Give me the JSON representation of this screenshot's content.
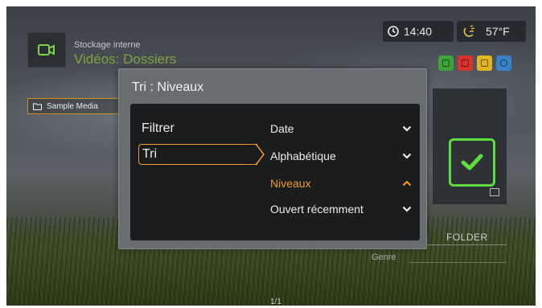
{
  "header": {
    "breadcrumb_top": "Stockage interne",
    "title": "Vidéos: Dossiers",
    "time": "14:40",
    "temperature": "57°F"
  },
  "color_keys": [
    {
      "name": "green-key",
      "color": "#3fa33a"
    },
    {
      "name": "red-key",
      "color": "#d8342c"
    },
    {
      "name": "yellow-key",
      "color": "#e1b61e"
    },
    {
      "name": "blue-key",
      "color": "#3a82c6"
    }
  ],
  "browser": {
    "sample_item": "Sample Media",
    "folder_label": "FOLDER",
    "genre_label": "Genre",
    "page_count": "1/1"
  },
  "dialog": {
    "title": "Tri : Niveaux",
    "menu": [
      {
        "label": "Filtrer",
        "selected": false
      },
      {
        "label": "Tri",
        "selected": true
      }
    ],
    "options": [
      {
        "label": "Date",
        "chevron": "down",
        "active": false
      },
      {
        "label": "Alphabétique",
        "chevron": "down",
        "active": false
      },
      {
        "label": "Niveaux",
        "chevron": "up",
        "active": true
      },
      {
        "label": "Ouvert récemment",
        "chevron": "down",
        "active": false
      }
    ]
  },
  "colors": {
    "accent_orange": "#f29b1d",
    "confirm_green": "#5edc3e",
    "title_green": "#8fbf3a"
  }
}
